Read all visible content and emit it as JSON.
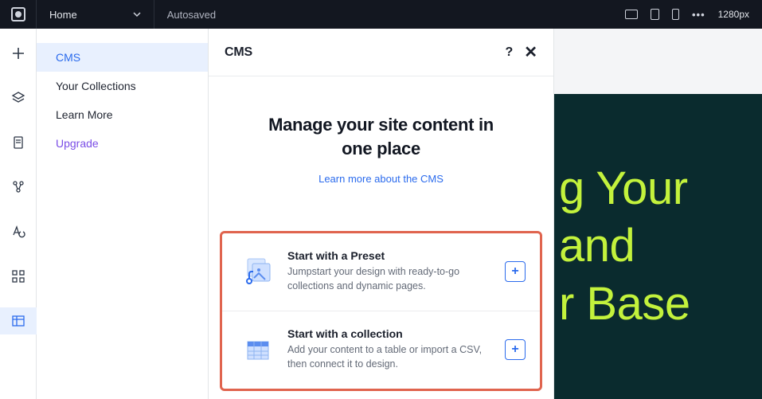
{
  "topbar": {
    "page_name": "Home",
    "autosave_label": "Autosaved",
    "viewport": "1280px",
    "more_label": "•••"
  },
  "sidebar": {
    "items": [
      {
        "label": "CMS"
      },
      {
        "label": "Your Collections"
      },
      {
        "label": "Learn More"
      },
      {
        "label": "Upgrade"
      }
    ]
  },
  "panel": {
    "title": "CMS",
    "heading": "Manage your site content in one place",
    "learn_link": "Learn more about the CMS",
    "options": [
      {
        "title": "Start with a Preset",
        "desc": "Jumpstart your design with ready-to-go collections and dynamic pages."
      },
      {
        "title": "Start with a collection",
        "desc": "Add your content to a table or import a CSV, then connect it to design."
      }
    ]
  },
  "canvas": {
    "hero_text": "g Your\n and\nr Base"
  }
}
